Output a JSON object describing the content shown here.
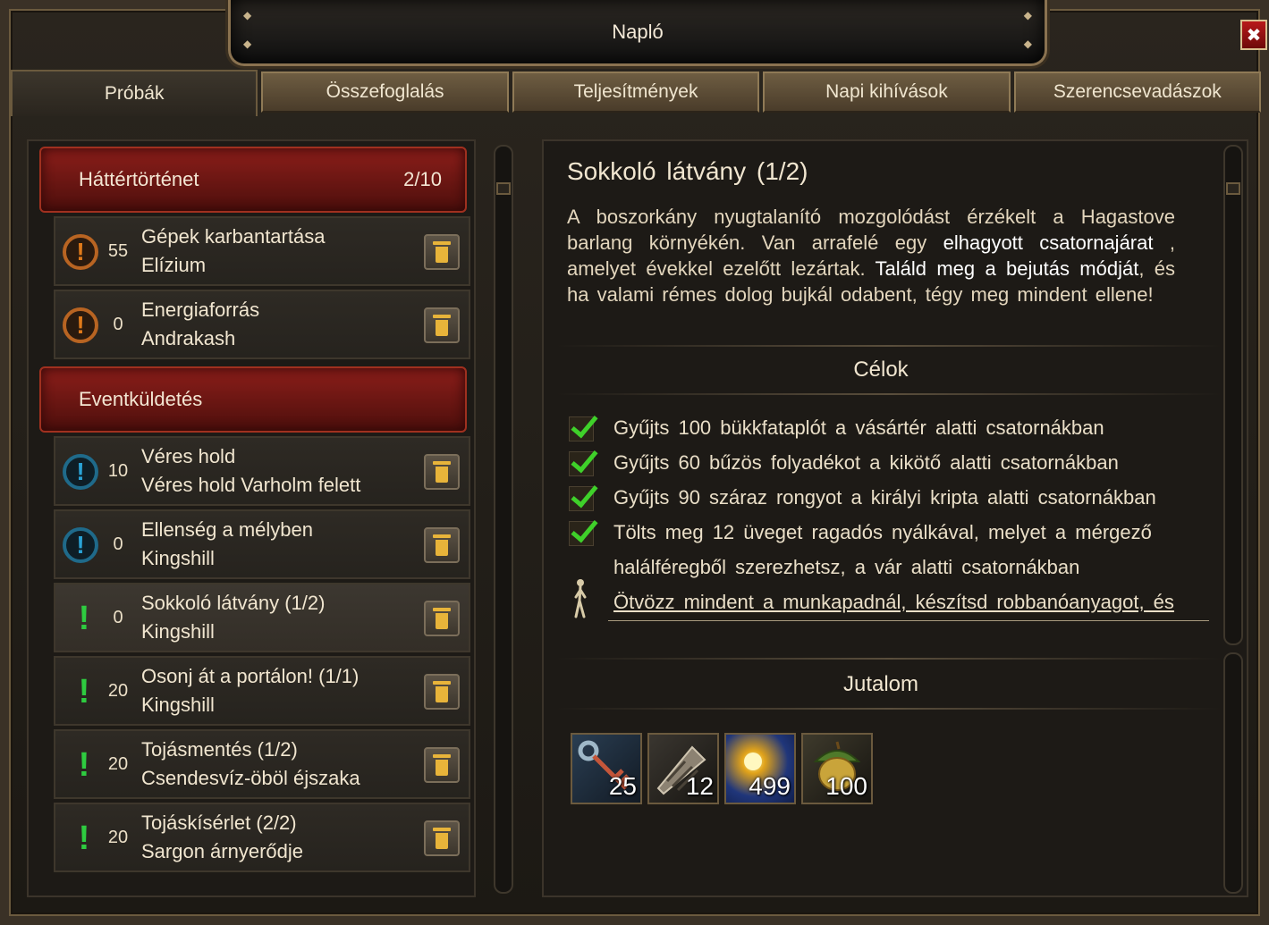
{
  "window": {
    "title": "Napló"
  },
  "tabs": [
    {
      "label": "Próbák",
      "active": true
    },
    {
      "label": "Összefoglalás",
      "active": false
    },
    {
      "label": "Teljesítmények",
      "active": false
    },
    {
      "label": "Napi  kihívások",
      "active": false
    },
    {
      "label": "Szerencsevadászok",
      "active": false
    }
  ],
  "left": {
    "categories": [
      {
        "label": "Háttértörténet",
        "count": "2/10"
      },
      {
        "label": "Eventküldetés",
        "count": ""
      }
    ],
    "quests": [
      {
        "icon": "orange-exclamation-icon",
        "count": "55",
        "title": "Gépek  karbantartása",
        "sub": "Elízium",
        "selected": false
      },
      {
        "icon": "orange-exclamation-icon",
        "count": "0",
        "title": "Energiaforrás",
        "sub": "Andrakash",
        "selected": false
      },
      {
        "icon": "blue-exclamation-icon",
        "count": "10",
        "title": "Véres  hold",
        "sub": "Véres  hold  Varholm  felett",
        "selected": false
      },
      {
        "icon": "blue-exclamation-icon",
        "count": "0",
        "title": "Ellenség  a  mélyben",
        "sub": "Kingshill",
        "selected": false
      },
      {
        "icon": "green-exclamation-icon",
        "count": "0",
        "title": "Sokkoló  látvány  (1/2)",
        "sub": "Kingshill",
        "selected": true
      },
      {
        "icon": "green-exclamation-icon",
        "count": "20",
        "title": "Osonj  át  a  portálon!  (1/1)",
        "sub": "Kingshill",
        "selected": false
      },
      {
        "icon": "green-exclamation-icon",
        "count": "20",
        "title": "Tojásmentés  (1/2)",
        "sub": "Csendesvíz-öböl  éjszaka",
        "selected": false
      },
      {
        "icon": "green-exclamation-icon",
        "count": "20",
        "title": "Tojáskísérlet  (2/2)",
        "sub": "Sargon  árnyerődje",
        "selected": false
      }
    ]
  },
  "detail": {
    "title": "Sokkoló  látvány  (1/2)",
    "desc_parts": [
      "A  boszorkány  nyugtalanító  mozgolódást  érzékelt  a  Hagastove  barlang  környékén.  Van  arrafelé  egy ",
      "elhagyott  csatornajárat",
      " ,  amelyet  évekkel  ezelőtt  lezártak. ",
      "Találd  meg  a  bejutás  módját",
      ",  és  ha  valami  rémes  dolog  bujkál  odabent,  tégy  meg  mindent  ellene!"
    ],
    "goals_title": "Célok",
    "goals": [
      "Gyűjts  100  bükkfataplót  a  vásártér  alatti  csatornákban",
      "Gyűjts  60  bűzös  folyadékot  a  kikötő  alatti  csatornákban",
      "Gyűjts  90  száraz  rongyot  a  királyi  kripta  alatti  csatornákban",
      "Tölts  meg  12  üveget  ragadós  nyálkával,  melyet  a  mérgező",
      "halálféregből  szerezhetsz,  a  vár  alatti  csatornákban"
    ],
    "pending_goal": "Ötvözz  mindent  a  munkapadnál,  készítsd  robbanóanyagot,  és",
    "reward_title": "Jutalom",
    "rewards": [
      {
        "icon": "key-icon",
        "amount": "25"
      },
      {
        "icon": "drill-icon",
        "amount": "12"
      },
      {
        "icon": "sun-star-icon",
        "amount": "499"
      },
      {
        "icon": "acorn-icon",
        "amount": "100"
      }
    ]
  },
  "colors": {
    "accent_red": "#8c1e1a",
    "check_green": "#3fd12a",
    "trash_gold": "#e8b43a"
  }
}
